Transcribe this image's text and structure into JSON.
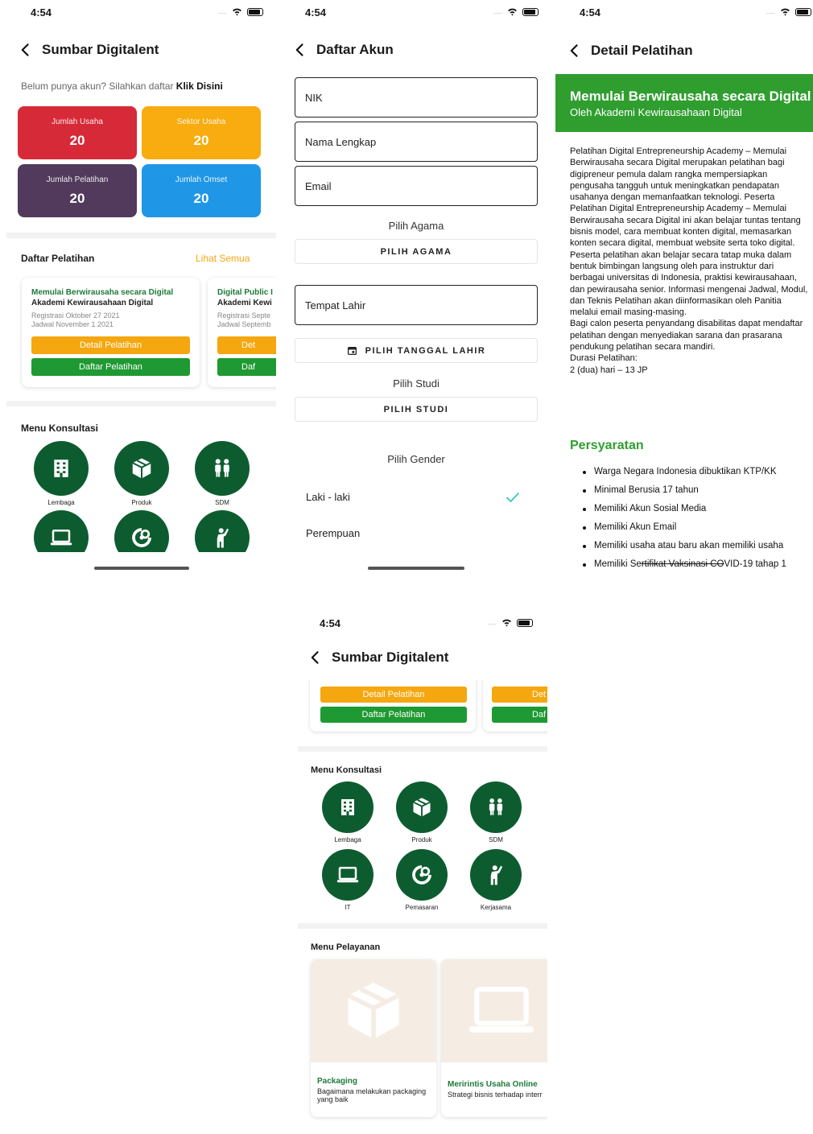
{
  "status": {
    "time": "4:54",
    "dots": "....."
  },
  "screen1": {
    "nav_title": "Sumbar Digitalent",
    "cta_prefix": "Belum punya akun? Silahkan daftar ",
    "cta_link": "Klik Disini",
    "stats": [
      {
        "label": "Jumlah Usaha",
        "value": "20",
        "color": "#d72a38"
      },
      {
        "label": "Sektor Usaha",
        "value": "20",
        "color": "#f8ac0f"
      },
      {
        "label": "Jumlah Pelatihan",
        "value": "20",
        "color": "#513a5c"
      },
      {
        "label": "Jumlah Omset",
        "value": "20",
        "color": "#1f97e6"
      }
    ],
    "pelatihan_title": "Daftar Pelatihan",
    "lihat_semua": "Lihat Semua",
    "cards": [
      {
        "title": "Memulai Berwirausaha secara Digital",
        "org": "Akademi Kewirausahaan Digital",
        "reg": "Registrasi Oktober 27 2021",
        "jadwal": "Jadwal November 1 2021",
        "detail_btn": "Detail Pelatihan",
        "daftar_btn": "Daftar Pelatihan"
      },
      {
        "title": "Digital Public I",
        "org": "Akademi Kewi",
        "reg": "Registrasi Septe",
        "jadwal": "Jadwal Septemb",
        "detail_btn": "Det",
        "daftar_btn": "Daf"
      }
    ],
    "konsultasi_title": "Menu Konsultasi",
    "menu": [
      {
        "label": "Lembaga",
        "icon": "building-icon"
      },
      {
        "label": "Produk",
        "icon": "box-icon"
      },
      {
        "label": "SDM",
        "icon": "people-icon"
      }
    ]
  },
  "screen2": {
    "nav_title": "Daftar Akun",
    "fields": {
      "nik": "NIK",
      "nama": "Nama Lengkap",
      "email": "Email",
      "tempat_lahir": "Tempat Lahir"
    },
    "agama_label": "Pilih Agama",
    "agama_btn": "PILIH AGAMA",
    "tanggal_btn": "PILIH TANGGAL LAHIR",
    "studi_label": "Pilih Studi",
    "studi_btn": "PILIH STUDI",
    "gender_label": "Pilih Gender",
    "gender_options": [
      {
        "label": "Laki - laki",
        "selected": true
      },
      {
        "label": "Perempuan",
        "selected": false
      }
    ]
  },
  "screen3": {
    "nav_title": "Detail Pelatihan",
    "banner_title": "Memulai Berwirausaha secara Digital",
    "banner_sub": "Oleh Akademi Kewirausahaan Digital",
    "desc": [
      "Pelatihan Digital Entrepreneurship Academy – Memulai Berwirausaha secara Digital merupakan pelatihan bagi digipreneur pemula dalam rangka mempersiapkan pengusaha tangguh untuk meningkatkan pendapatan usahanya dengan memanfaatkan teknologi. Peserta Pelatihan Digital Entrepreneurship Academy – Memulai Berwirausaha secara Digital ini akan belajar tuntas tentang bisnis model, cara membuat konten digital, memasarkan konten secara digital, membuat website serta toko digital.",
      "Peserta pelatihan akan belajar secara tatap muka dalam bentuk bimbingan langsung oleh para instruktur dari berbagai universitas di Indonesia, praktisi kewirausahaan, dan pewirausaha senior. Informasi mengenai Jadwal, Modul, dan Teknis Pelatihan akan diinformasikan oleh Panitia melalui email masing-masing.",
      "Bagi calon peserta penyandang disabilitas dapat mendaftar pelatihan dengan menyediakan sarana dan prasarana pendukung pelatihan secara mandiri.",
      "Durasi Pelatihan:",
      "2 (dua) hari – 13 JP"
    ],
    "req_title": "Persyaratan",
    "requirements": [
      "Warga Negara Indonesia dibuktikan KTP/KK",
      "Minimal Berusia 17 tahun",
      "Memiliki Akun Sosial Media",
      "Memiliki Akun Email",
      "Memiliki usaha atau baru akan memiliki usaha"
    ],
    "req_last_prefix": "Memiliki Se",
    "req_last_strike": "rtifikat Vaksinasi CO",
    "req_last_suffix": "VID-19 tahap 1"
  },
  "screen4": {
    "nav_title": "Sumbar Digitalent",
    "detail_btn": "Detail Pelatihan",
    "daftar_btn": "Daftar Pelatihan",
    "detail_btn_2": "Det",
    "daftar_btn_2": "Daf",
    "konsultasi_title": "Menu Konsultasi",
    "menu": [
      {
        "label": "Lembaga",
        "icon": "building-icon"
      },
      {
        "label": "Produk",
        "icon": "box-icon"
      },
      {
        "label": "SDM",
        "icon": "people-icon"
      },
      {
        "label": "IT",
        "icon": "laptop-icon"
      },
      {
        "label": "Pemasaran",
        "icon": "marketing-icon"
      },
      {
        "label": "Kerjasama",
        "icon": "handshake-icon"
      }
    ],
    "pelayanan_title": "Menu Pelayanan",
    "services": [
      {
        "title": "Packaging",
        "desc": "Bagaimana melakukan packaging yang baik"
      },
      {
        "title": "Meririntis Usaha Online",
        "desc": "Strategi bisnis terhadap interr"
      }
    ]
  },
  "colors": {
    "green_dark": "#0d5c2f",
    "green": "#2f9e2f",
    "orange": "#f5a70f",
    "check": "#33c6c6"
  }
}
